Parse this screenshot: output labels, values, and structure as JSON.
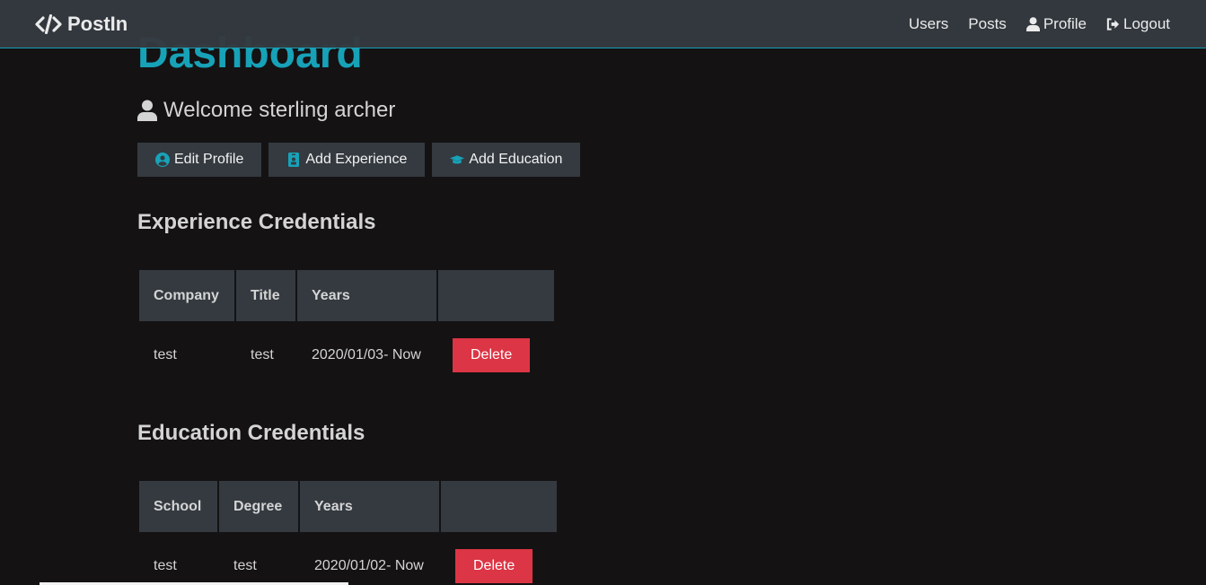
{
  "navbar": {
    "brand": "PostIn",
    "brand_icon": "code-icon",
    "links": [
      {
        "label": "Users"
      },
      {
        "label": "Posts"
      },
      {
        "label": "Profile",
        "icon": "user-icon"
      },
      {
        "label": "Logout",
        "icon": "sign-out-icon"
      }
    ]
  },
  "page": {
    "title": "Dashboard",
    "welcome": "Welcome sterling archer",
    "buttons": [
      {
        "label": "Edit Profile",
        "icon": "user-circle-icon"
      },
      {
        "label": "Add Experience",
        "icon": "id-badge-icon"
      },
      {
        "label": "Add Education",
        "icon": "graduation-cap-icon"
      }
    ]
  },
  "experience": {
    "title": "Experience Credentials",
    "headers": [
      "Company",
      "Title",
      "Years",
      ""
    ],
    "rows": [
      {
        "company": "test",
        "title": "test",
        "years": "2020/01/03- Now",
        "action": "Delete"
      }
    ]
  },
  "education": {
    "title": "Education Credentials",
    "headers": [
      "School",
      "Degree",
      "Years",
      ""
    ],
    "rows": [
      {
        "school": "test",
        "degree": "test",
        "years": "2020/01/02- Now",
        "action": "Delete"
      }
    ]
  },
  "colors": {
    "accent": "#17a2b8",
    "dark": "#343a40",
    "danger": "#dc3545",
    "background": "#141213"
  }
}
